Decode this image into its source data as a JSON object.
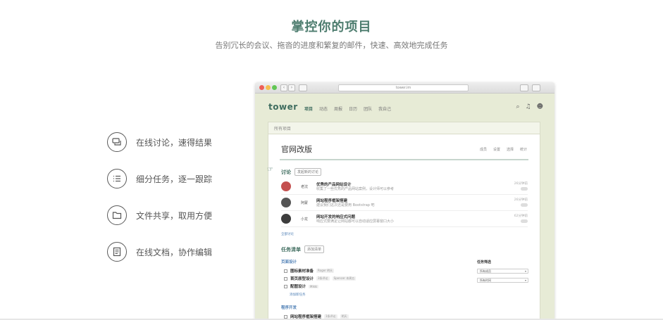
{
  "hero": {
    "title": "掌控你的项目",
    "subtitle": "告别冗长的会议、拖沓的进度和繁复的邮件，快速、高效地完成任务"
  },
  "features": [
    {
      "label": "在线讨论，速得结果",
      "icon": "discussion-icon"
    },
    {
      "label": "细分任务，逐一跟踪",
      "icon": "task-list-icon"
    },
    {
      "label": "文件共享，取用方便",
      "icon": "folder-icon"
    },
    {
      "label": "在线文档，协作编辑",
      "icon": "document-icon"
    }
  ],
  "browser": {
    "url": "tower.im",
    "nav_back": "‹",
    "nav_forward": "›",
    "app": {
      "logo": "tower",
      "nav": [
        "项目",
        "动态",
        "周报",
        "日历",
        "团队",
        "我自己"
      ],
      "icons": [
        "search-icon",
        "bell-icon",
        "avatar-icon"
      ]
    },
    "breadcrumb": "所有项目",
    "project": {
      "title": "官网改版",
      "tools": [
        "成员",
        "设置",
        "选择",
        "统计"
      ],
      "discussion": {
        "title": "讨论",
        "button": "发起新的讨论",
        "topics": [
          {
            "name": "老沈",
            "title": "优秀的产品网站设计",
            "snippet": "收集了一些优秀的产品网站案例，设计师可以参考",
            "time": "26分钟前"
          },
          {
            "name": "阿蒙",
            "title": "网站程序框架搭建",
            "snippet": "建议我们这次还是要用 Bootstrap 吧",
            "time": "26分钟前"
          },
          {
            "name": "小龙",
            "title": "网站开发的响应式问题",
            "snippet": "响应式要满足让网站都可以自动适应屏幕窗口大小",
            "time": "62分钟前"
          }
        ],
        "all_link": "全部讨论"
      },
      "tasks": {
        "title": "任务清单",
        "button": "添加清单",
        "groups": [
          {
            "name": "页面设计",
            "items": [
              {
                "label": "图标素材准备",
                "tags": [
                  "Roger 明天"
                ]
              },
              {
                "label": "首页原型设计",
                "tags": [
                  "3条评论",
                  "Spencer 本周五"
                ]
              },
              {
                "label": "配图设计",
                "tags": [
                  "Mikki"
                ]
              }
            ],
            "add_link": "添加新任务"
          },
          {
            "name": "程序开发",
            "items": [
              {
                "label": "网站程序框架搭建",
                "tags": [
                  "1条评论",
                  "明天"
                ]
              }
            ]
          }
        ],
        "filter": {
          "title": "任务筛选",
          "options": [
            "所有成员",
            "所有时间"
          ]
        }
      }
    }
  },
  "colors": {
    "accent": "#4e7d6f",
    "link": "#4e7fb5",
    "browser_bg": "#e7ebd6"
  }
}
